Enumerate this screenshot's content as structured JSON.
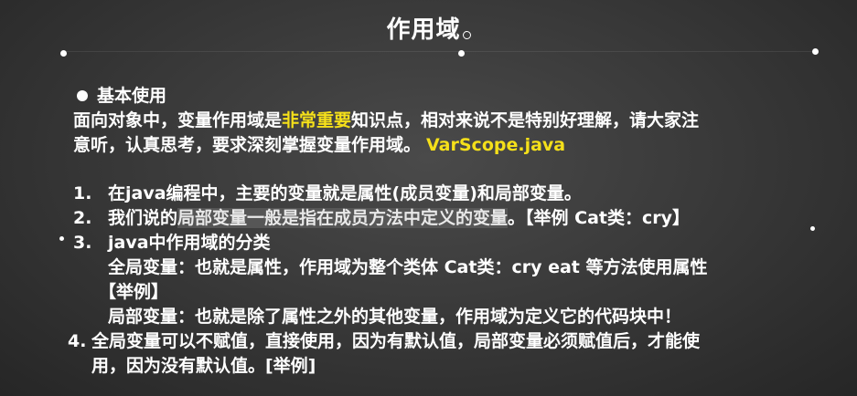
{
  "slide": {
    "title": "作用域",
    "section_heading": "基本使用",
    "intro": {
      "part1": "面向对象中，变量作用域是",
      "highlight": "非常重要",
      "part2": "知识点，相对来说不是特别好理解，请大家注",
      "line2": "意听，认真思考，要求深刻掌握变量作用域。",
      "file_ref": "VarScope.java"
    },
    "items": [
      {
        "number": "1.",
        "text": "在java编程中，主要的变量就是属性(成员变量)和局部变量。"
      },
      {
        "number": "2.",
        "prefix": "我们说的",
        "highlighted": "局部变量一般是指在成员方法中定义的变量",
        "suffix": "。【举例 Cat类：cry】"
      },
      {
        "number": "3.",
        "text": "java中作用域的分类",
        "sub_global_line1": "全局变量：也就是属性，作用域为整个类体 Cat类：cry eat 等方法使用属性",
        "sub_global_line2": "【举例】",
        "sub_local": "局部变量：也就是除了属性之外的其他变量，作用域为定义它的代码块中！"
      },
      {
        "number": "4.",
        "line1": "全局变量可以不赋值，直接使用，因为有默认值，局部变量必须赋值后，才能使",
        "line2": "用，因为没有默认值。[举例]"
      }
    ]
  },
  "colors": {
    "background": "#3a3a3a",
    "text": "#ffffff",
    "accent_yellow": "#f5e01a"
  }
}
